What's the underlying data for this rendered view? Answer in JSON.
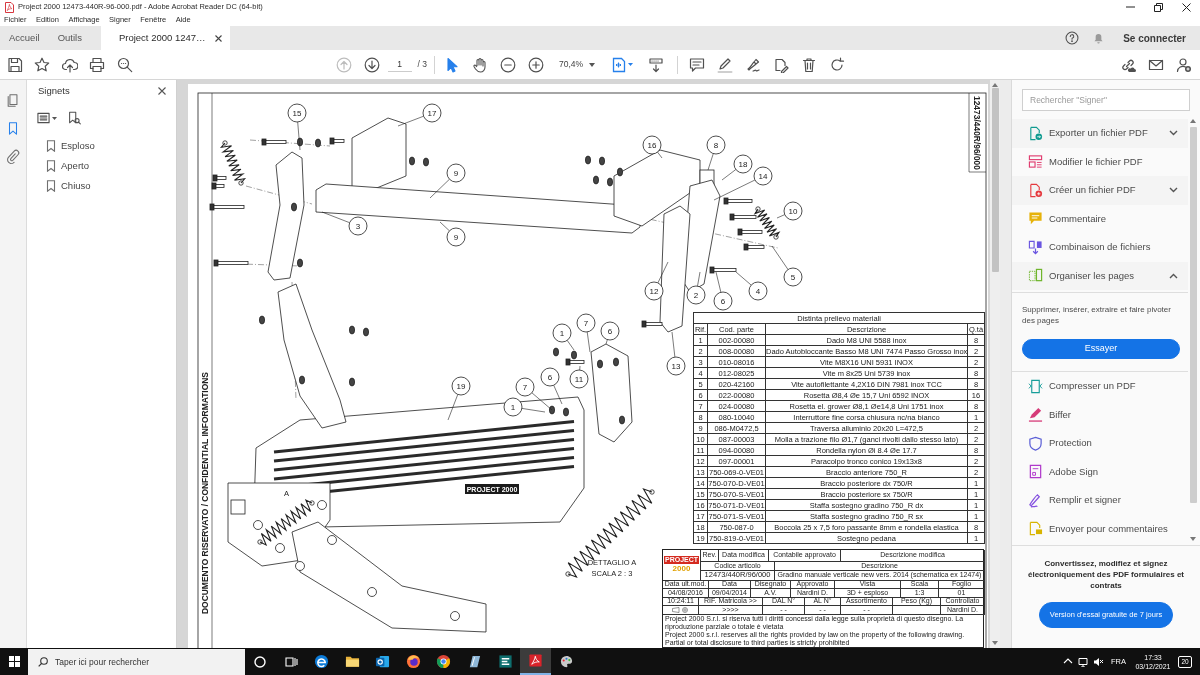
{
  "window": {
    "title": "Project 2000 12473-440R-96-000.pdf - Adobe Acrobat Reader DC (64-bit)"
  },
  "menu": [
    "Fichier",
    "Edition",
    "Affichage",
    "Signer",
    "Fenêtre",
    "Aide"
  ],
  "tabs": [
    {
      "label": "Accueil",
      "selected": false
    },
    {
      "label": "Outils",
      "selected": false
    },
    {
      "label": "Project 2000 1247…",
      "selected": true
    }
  ],
  "account": {
    "label": "Se connecter"
  },
  "toolbar": {
    "page_up": {
      "disabled": true
    },
    "page_down": {
      "disabled": false
    },
    "page": "1",
    "page_count": "/ 3",
    "modes": [
      {
        "kind": "pointer",
        "selected": true
      },
      {
        "kind": "hand",
        "selected": false
      }
    ],
    "zoom": "70,4%"
  },
  "navigation": [
    {
      "kind": "pages",
      "selected": false
    },
    {
      "kind": "bookmarks",
      "selected": true
    },
    {
      "kind": "attachments",
      "selected": false
    }
  ],
  "bookmarks": {
    "title": "Signets",
    "items": [
      {
        "label": "Esploso"
      },
      {
        "label": "Aperto"
      },
      {
        "label": "Chiuso"
      }
    ]
  },
  "drawing": {
    "sheet_code": "12473/440R/96/000",
    "confidential": "DOCUMENTO RISERVATO / CONFIDENTIAL INFORMATIONS",
    "callouts": [
      "15",
      "17",
      "9",
      "16",
      "8",
      "18",
      "14",
      "10",
      "3",
      "9",
      "12",
      "2",
      "6",
      "4",
      "5",
      "13",
      "1",
      "7",
      "6",
      "11",
      "7",
      "6",
      "1",
      "19"
    ],
    "tread_logo": "PROJECT 2000",
    "detail_marker": "A",
    "detail_caption": [
      "DETTAGLIO A",
      "SCALA 2 : 3"
    ],
    "parts_list": {
      "title": "Distinta prelievo materiali",
      "columns": [
        "Rif.",
        "Cod. parte",
        "Descrizione",
        "Q.tà"
      ],
      "rows": [
        [
          "1",
          "002-00080",
          "Dado M8 UNI 5588 inox",
          "8"
        ],
        [
          "2",
          "008-00080",
          "Dado Autobloccante Basso M8 UNI 7474 Passo Grosso inox",
          "2"
        ],
        [
          "3",
          "010-08016",
          "Vite M8X16 UNI 5931 INOX",
          "2"
        ],
        [
          "4",
          "012-08025",
          "Vite m 8x25 Uni 5739 inox",
          "8"
        ],
        [
          "5",
          "020-42160",
          "Vite autofilettante 4,2X16 DIN 7981 inox TCC",
          "8"
        ],
        [
          "6",
          "022-00080",
          "Rosetta Ø8,4 Øe 15,7 Uni 6592 INOX",
          "16"
        ],
        [
          "7",
          "024-00080",
          "Rosetta el. grower Ø8,1 Øe14,8 Uni 1751 inox",
          "8"
        ],
        [
          "8",
          "080-10040",
          "Interruttore fine corsa chiusura nc/na bianco",
          "1"
        ],
        [
          "9",
          "086-M0472,5",
          "Traversa alluminio 20x20 L=472,5",
          "2"
        ],
        [
          "10",
          "087-00003",
          "Molla a trazione filo Ø1,7 (ganci rivolti dallo stesso lato)",
          "2"
        ],
        [
          "11",
          "094-00080",
          "Rondella nylon  Øi 8.4   Øe 17.7",
          "8"
        ],
        [
          "12",
          "097-00001",
          "Paracolpo tronco conico 19x13x8",
          "2"
        ],
        [
          "13",
          "750-069-0-VE01",
          "Braccio anteriore 750_R",
          "2"
        ],
        [
          "14",
          "750-070-D-VE01",
          "Braccio posteriore dx 750/R",
          "1"
        ],
        [
          "15",
          "750-070-S-VE01",
          "Braccio posteriore sx 750/R",
          "1"
        ],
        [
          "16",
          "750-071-D-VE01",
          "Staffa sostegno gradino 750_R dx",
          "1"
        ],
        [
          "17",
          "750-071-S-VE01",
          "Staffa sostegno gradino 750_R sx",
          "1"
        ],
        [
          "18",
          "750-087-0",
          "Boccola 25 x 7,5 foro passante 8mm e rondella elastica",
          "8"
        ],
        [
          "19",
          "750-819-0-VE01",
          "Sostegno pedana",
          "1"
        ]
      ]
    },
    "title_block": {
      "logo": [
        "PROJECT",
        "2000"
      ],
      "revision_columns": [
        "Rev.",
        "Data modifica",
        "Contabile approvato",
        "Descrizione modifica"
      ],
      "code_label": "Codice articolo",
      "description_label": "Descrizione",
      "code": "12473/440R/96/000",
      "description": "Gradino manuale verticale new vers. 2014 (schematica ex 12474)",
      "info_labels": [
        "Data ult.mod.",
        "Data",
        "Disegnato",
        "Approvato",
        "Vista",
        "Scala",
        "Foglio"
      ],
      "info_values": [
        "04/08/2016",
        "09/04/2014",
        "A.V.",
        "Nardini D.",
        "3D + esploso",
        "1:3",
        "01"
      ],
      "serial_labels": [
        "10:24:11",
        "RIF. Matricola >>",
        "DAL N°",
        "AL N°",
        "Assortimento",
        "Peso (Kg)",
        "Controllato"
      ],
      "serial_values": [
        ">>>>",
        "- -",
        "- -",
        "- -",
        "Nardini D."
      ],
      "notice": [
        "Project 2000 S.r.l. si riserva tutti i diritti concessi dalla legge sulla proprietà di questo disegno. La riproduzione parziale o totale è vietata",
        "Project 2000 s.r.l. reserves all the rights provided by law on the property of the following drawing. Partial or total disclosure to third parties is strictly prohibited"
      ]
    }
  },
  "tools_panel": {
    "search_placeholder": "Rechercher \"Signer\"",
    "tools": [
      {
        "label": "Exporter un fichier PDF",
        "kind": "export",
        "expanded": false
      },
      {
        "label": "Modifier le fichier PDF",
        "kind": "edit"
      },
      {
        "label": "Créer un fichier PDF",
        "kind": "create",
        "expanded": false
      },
      {
        "label": "Commentaire",
        "kind": "comment"
      },
      {
        "label": "Combinaison de fichiers",
        "kind": "combine"
      },
      {
        "label": "Organiser les pages",
        "kind": "organize",
        "expanded": true,
        "details": "Supprimer, insérer, extraire et faire pivoter des pages",
        "action": "Essayer"
      },
      {
        "label": "Compresser un PDF",
        "kind": "compress"
      },
      {
        "label": "Biffer",
        "kind": "redact"
      },
      {
        "label": "Protection",
        "kind": "protect"
      },
      {
        "label": "Adobe Sign",
        "kind": "sign"
      },
      {
        "label": "Remplir et signer",
        "kind": "fill"
      },
      {
        "label": "Envoyer pour commentaires",
        "kind": "send"
      }
    ],
    "promo": {
      "text": "Convertissez, modifiez et signez électroniquement des PDF formulaires et contrats",
      "button": "Version d'essai gratuite de 7 jours"
    }
  },
  "taskbar": {
    "search_placeholder": "Taper ici pour rechercher",
    "apps": [
      {
        "kind": "edge",
        "selected": false
      },
      {
        "kind": "folder",
        "selected": false
      },
      {
        "kind": "outlook",
        "selected": false
      },
      {
        "kind": "firefox",
        "selected": false
      },
      {
        "kind": "chrome",
        "selected": false
      },
      {
        "kind": "notes",
        "selected": false
      },
      {
        "kind": "tiles",
        "selected": false
      },
      {
        "kind": "acrobat",
        "selected": true
      },
      {
        "kind": "palette",
        "selected": false
      }
    ],
    "language": "FRA",
    "time": "17:33",
    "date": "03/12/2021",
    "notifications": "20"
  }
}
